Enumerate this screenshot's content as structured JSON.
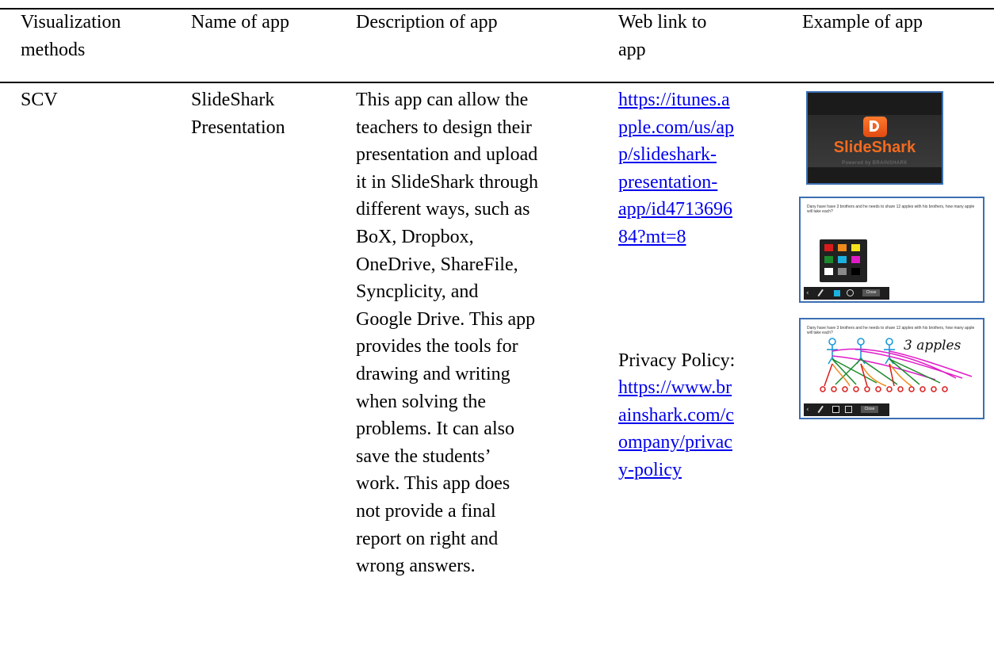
{
  "table": {
    "headers": [
      "Visualization\nmethods",
      "Name of app",
      "Description of app",
      "Web link to\napp",
      "Example of app"
    ],
    "row": {
      "method": "SCV",
      "name": "SlideShark\nPresentation",
      "description": "This app can allow the\nteachers to design their\npresentation and upload\nit in SlideShark through\ndifferent ways, such as\nBoX, Dropbox,\nOneDrive, ShareFile,\nSyncplicity, and\nGoogle Drive. This app\nprovides the tools for\ndrawing and writing\nwhen solving the\nproblems. It can also\nsave the students’\nwork. This app does\nnot provide a final\nreport on right and\nwrong answers.",
      "app_link": "https://itunes.a\npple.com/us/ap\np/slideshark-\npresentation-\napp/id4713696\n84?mt=8",
      "privacy_label": "Privacy Policy:",
      "privacy_link": "https://www.br\nainshark.com/c\nompany/privac\ny-policy"
    }
  },
  "examples": {
    "logo_text": "SlideShark",
    "powered_by": "Powered by BRAINSHARK",
    "question": "Dany have have 3 brothers and he needs to share 12 apples with his brothers, how many apple will take each?",
    "close_label": "Close",
    "handwritten_note": "3 apples",
    "palette_colors": [
      "#d81c1c",
      "#f08a1c",
      "#f4e21c",
      "#1c8a2c",
      "#1cb0e0",
      "#e01cc8",
      "#ffffff",
      "#8a8a8a",
      "#000000"
    ]
  }
}
